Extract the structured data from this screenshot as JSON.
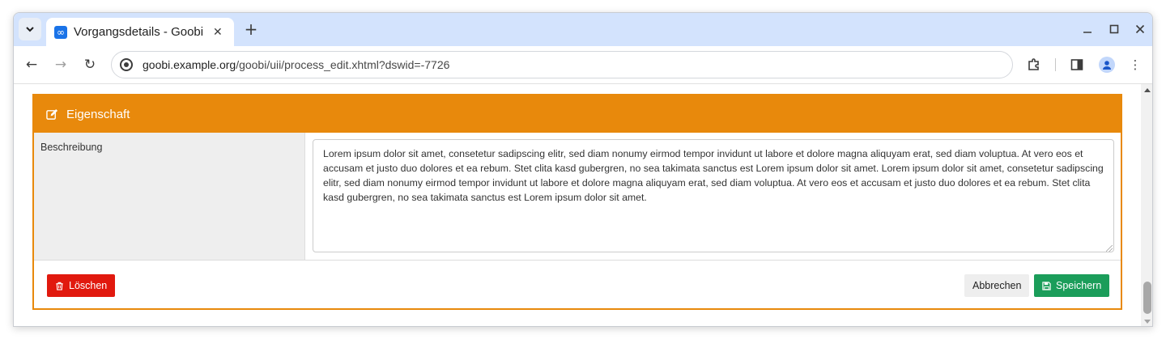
{
  "browser": {
    "tab_title": "Vorgangsdetails - Goobi",
    "tab_close_glyph": "✕",
    "new_tab_glyph": "+",
    "url_host": "goobi.example.org",
    "url_path": "/goobi/uii/process_edit.xhtml?dswid=-7726",
    "back_glyph": "←",
    "forward_glyph": "→",
    "reload_glyph": "↻",
    "minimize_glyph": "—",
    "maximize_glyph": "☐",
    "close_glyph": "✕",
    "menu_glyph": "⋮",
    "accent": "#d3e3fd"
  },
  "panel": {
    "title": "Eigenschaft",
    "accent": "#e8890c",
    "field_label": "Beschreibung",
    "field_value": "Lorem ipsum dolor sit amet, consetetur sadipscing elitr, sed diam nonumy eirmod tempor invidunt ut labore et dolore magna aliquyam erat, sed diam voluptua. At vero eos et accusam et justo duo dolores et ea rebum. Stet clita kasd gubergren, no sea takimata sanctus est Lorem ipsum dolor sit amet. Lorem ipsum dolor sit amet, consetetur sadipscing elitr, sed diam nonumy eirmod tempor invidunt ut labore et dolore magna aliquyam erat, sed diam voluptua. At vero eos et accusam et justo duo dolores et ea rebum. Stet clita kasd gubergren, no sea takimata sanctus est Lorem ipsum dolor sit amet."
  },
  "actions": {
    "delete_label": "Löschen",
    "cancel_label": "Abbrechen",
    "save_label": "Speichern",
    "delete_color": "#e1190e",
    "save_color": "#1b9d5a"
  }
}
